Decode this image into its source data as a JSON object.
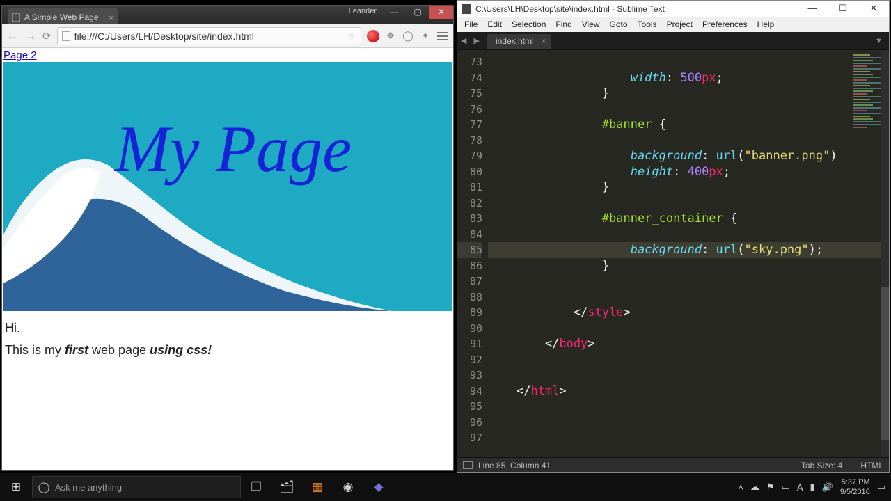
{
  "chrome": {
    "tab_title": "A Simple Web Page",
    "user": "Leander",
    "url": "file:///C:/Users/LH/Desktop/site/index.html",
    "page": {
      "link_text": "Page 2",
      "banner_title": "My Page",
      "line1": "Hi.",
      "line2_a": "This is my ",
      "line2_b": "first",
      "line2_c": " web page ",
      "line2_d": "using css!"
    }
  },
  "sublime": {
    "title": "C:\\Users\\LH\\Desktop\\site\\index.html - Sublime Text",
    "menus": [
      "File",
      "Edit",
      "Selection",
      "Find",
      "View",
      "Goto",
      "Tools",
      "Project",
      "Preferences",
      "Help"
    ],
    "tab": "index.html",
    "lines": {
      "start": 73,
      "end": 97,
      "current": 85
    },
    "code": {
      "l73": "",
      "l74_prop": "width",
      "l74_num": "500",
      "l74_unit": "px",
      "l77_sel": "#banner",
      "l79_prop": "background",
      "l79_func": "url",
      "l79_str": "\"banner.png\"",
      "l80_prop": "height",
      "l80_num": "400",
      "l80_unit": "px",
      "l83_sel": "#banner_container",
      "l85_prop": "background",
      "l85_func": "url",
      "l85_str": "\"sky.png\"",
      "l89_tag": "style",
      "l91_tag": "body",
      "l94_tag": "html"
    },
    "status": {
      "pos": "Line 85, Column 41",
      "tabsize": "Tab Size: 4",
      "syntax": "HTML"
    }
  },
  "taskbar": {
    "search_placeholder": "Ask me anything",
    "time": "5:37 PM",
    "date": "9/5/2016"
  }
}
